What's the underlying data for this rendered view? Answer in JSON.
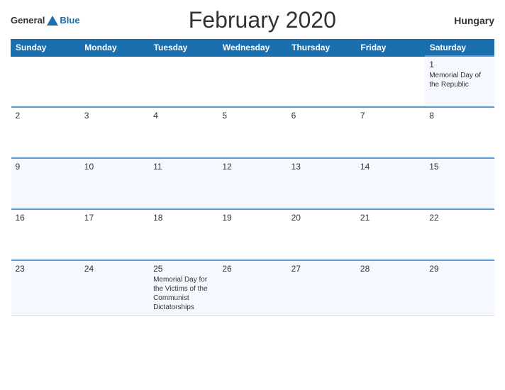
{
  "header": {
    "logo_general": "General",
    "logo_blue": "Blue",
    "title": "February 2020",
    "country": "Hungary"
  },
  "weekdays": [
    "Sunday",
    "Monday",
    "Tuesday",
    "Wednesday",
    "Thursday",
    "Friday",
    "Saturday"
  ],
  "weeks": [
    [
      {
        "num": "",
        "event": ""
      },
      {
        "num": "",
        "event": ""
      },
      {
        "num": "",
        "event": ""
      },
      {
        "num": "",
        "event": ""
      },
      {
        "num": "",
        "event": ""
      },
      {
        "num": "",
        "event": ""
      },
      {
        "num": "1",
        "event": "Memorial Day of the Republic"
      }
    ],
    [
      {
        "num": "2",
        "event": ""
      },
      {
        "num": "3",
        "event": ""
      },
      {
        "num": "4",
        "event": ""
      },
      {
        "num": "5",
        "event": ""
      },
      {
        "num": "6",
        "event": ""
      },
      {
        "num": "7",
        "event": ""
      },
      {
        "num": "8",
        "event": ""
      }
    ],
    [
      {
        "num": "9",
        "event": ""
      },
      {
        "num": "10",
        "event": ""
      },
      {
        "num": "11",
        "event": ""
      },
      {
        "num": "12",
        "event": ""
      },
      {
        "num": "13",
        "event": ""
      },
      {
        "num": "14",
        "event": ""
      },
      {
        "num": "15",
        "event": ""
      }
    ],
    [
      {
        "num": "16",
        "event": ""
      },
      {
        "num": "17",
        "event": ""
      },
      {
        "num": "18",
        "event": ""
      },
      {
        "num": "19",
        "event": ""
      },
      {
        "num": "20",
        "event": ""
      },
      {
        "num": "21",
        "event": ""
      },
      {
        "num": "22",
        "event": ""
      }
    ],
    [
      {
        "num": "23",
        "event": ""
      },
      {
        "num": "24",
        "event": ""
      },
      {
        "num": "25",
        "event": "Memorial Day for the Victims of the Communist Dictatorships"
      },
      {
        "num": "26",
        "event": ""
      },
      {
        "num": "27",
        "event": ""
      },
      {
        "num": "28",
        "event": ""
      },
      {
        "num": "29",
        "event": ""
      }
    ]
  ]
}
